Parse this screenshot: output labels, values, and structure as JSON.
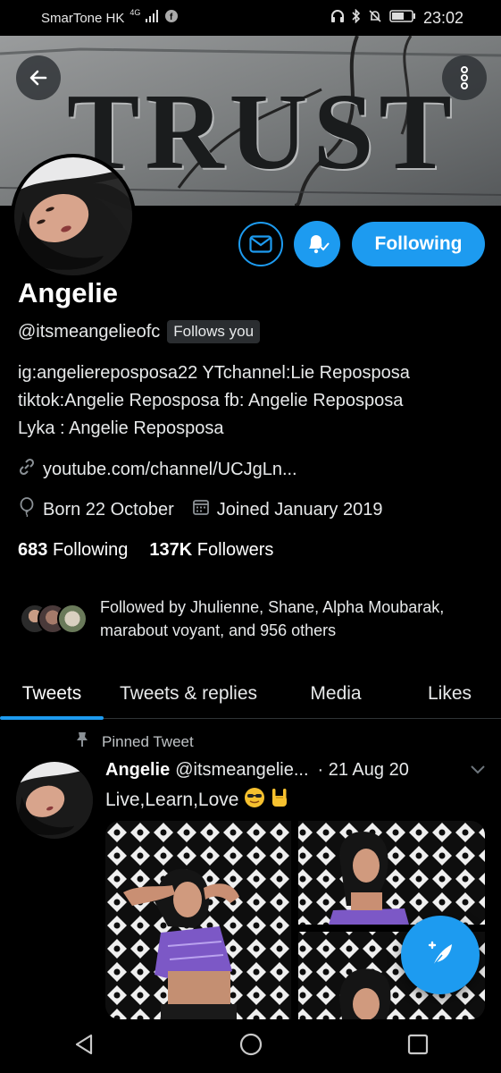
{
  "status_bar": {
    "carrier": "SmarTone HK",
    "network": "4G",
    "time": "23:02",
    "icons": [
      "signal-icon",
      "facebook-icon",
      "headphones-icon",
      "bluetooth-icon",
      "mute-icon",
      "battery-icon"
    ]
  },
  "banner": {
    "text": "TRUST"
  },
  "profile": {
    "name": "Angelie",
    "handle": "@itsmeangelieofc",
    "follows_you": "Follows you",
    "following_button": "Following",
    "bio_lines": [
      "ig:angelierepospos a22 YTchannel:Lie Reposposa",
      "tiktok:Angelie Reposposa fb: Angelie Reposposa",
      "Lyka : Angelie Reposposa"
    ],
    "bio_line1": "ig:angeliereposposa22 YTchannel:Lie Reposposa",
    "bio_line2": "tiktok:Angelie Reposposa fb: Angelie Reposposa",
    "bio_line3": "Lyka : Angelie Reposposa",
    "link": "youtube.com/channel/UCJgLn...",
    "born": "Born 22 October",
    "joined": "Joined January 2019",
    "following_count": "683",
    "following_label": "Following",
    "followers_count": "137K",
    "followers_label": "Followers",
    "followed_by_line1": "Followed by Jhulienne, Shane, Alpha Moubarak,",
    "followed_by_line2": "marabout voyant, and 956 others"
  },
  "tabs": [
    {
      "label": "Tweets",
      "active": true
    },
    {
      "label": "Tweets & replies",
      "active": false
    },
    {
      "label": "Media",
      "active": false
    },
    {
      "label": "Likes",
      "active": false
    }
  ],
  "pinned_tweet": {
    "pinned_label": "Pinned Tweet",
    "author_name": "Angelie",
    "author_handle": "@itsmeangelie...",
    "date": "· 21 Aug 20",
    "text": "Live,Learn,Love",
    "emojis": [
      "sunglasses-face",
      "rock-hand"
    ]
  },
  "colors": {
    "accent": "#1d9bf0",
    "background": "#000000",
    "text": "#ffffff"
  }
}
